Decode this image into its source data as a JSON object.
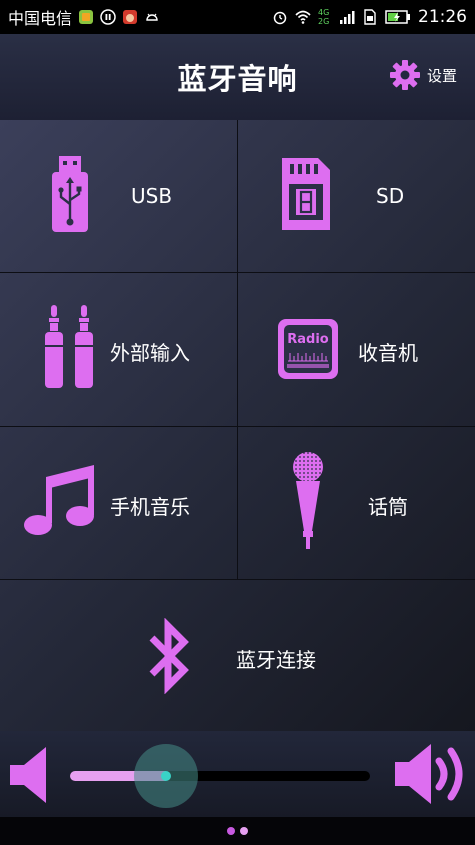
{
  "status_bar": {
    "carrier": "中国电信",
    "network": "4G 2G",
    "time": "21:26"
  },
  "header": {
    "title": "蓝牙音响",
    "settings_label": "设置"
  },
  "tiles": [
    {
      "label": "USB",
      "icon": "usb-drive-icon"
    },
    {
      "label": "SD",
      "icon": "sd-card-icon"
    },
    {
      "label": "外部输入",
      "icon": "audio-jack-icon"
    },
    {
      "label": "收音机",
      "icon": "radio-icon",
      "icon_text": "Radio"
    },
    {
      "label": "手机音乐",
      "icon": "music-note-icon"
    },
    {
      "label": "话筒",
      "icon": "microphone-icon"
    },
    {
      "label": "蓝牙连接",
      "icon": "bluetooth-icon"
    }
  ],
  "volume": {
    "level": 0.32
  },
  "pager": {
    "pages": 2,
    "current": 1
  },
  "colors": {
    "accent": "#dd6ef0",
    "accent_light": "#e6a0f0",
    "thumb": "#39d3c7"
  }
}
